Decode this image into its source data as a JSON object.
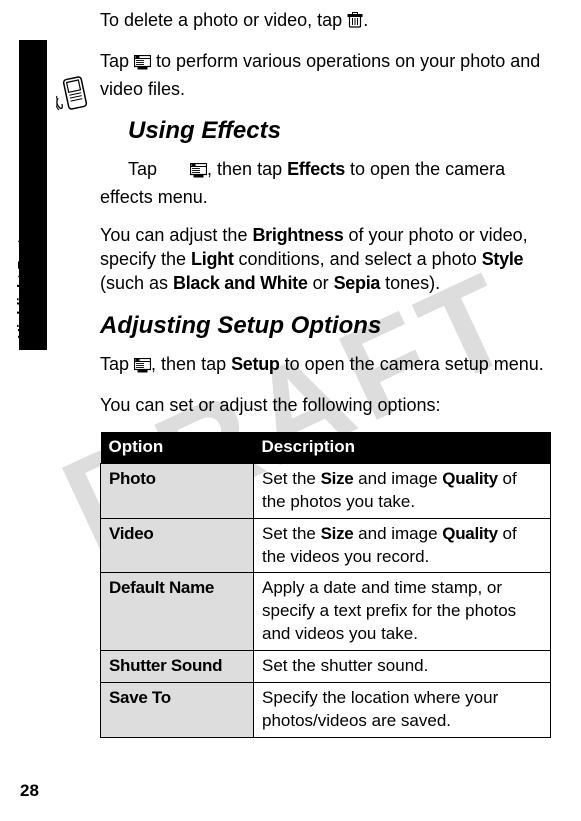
{
  "watermark": "DRAFT",
  "sidebar_label": "Highlight Features",
  "paragraphs": {
    "delete_pre": "To delete a photo or video, tap ",
    "delete_post": ".",
    "ops_pre": "Tap ",
    "ops_post": " to perform various operations on your photo and video files.",
    "effects_heading": "Using Effects",
    "effects_tap_pre": "Tap ",
    "effects_tap_mid": ", then tap ",
    "effects_tap_post": " to open the camera effects menu.",
    "effects_label": "Effects",
    "adjust_pre": "You can adjust the ",
    "adjust_brightness": "Brightness",
    "adjust_mid1": " of your photo or video, specify the ",
    "adjust_light": "Light",
    "adjust_mid2": " conditions, and select a photo ",
    "adjust_style": "Style",
    "adjust_mid3": " (such as ",
    "adjust_bw": "Black and White",
    "adjust_or": " or ",
    "adjust_sepia": "Sepia",
    "adjust_end": " tones).",
    "setup_heading": "Adjusting Setup Options",
    "setup_tap_pre": "Tap ",
    "setup_tap_mid": ", then tap ",
    "setup_tap_label": "Setup",
    "setup_tap_post": " to open the camera setup menu.",
    "options_intro": "You can set or adjust the following options:"
  },
  "table": {
    "header_option": "Option",
    "header_desc": "Description",
    "rows": [
      {
        "option": "Photo",
        "desc_pre": "Set the ",
        "desc_b1": "Size",
        "desc_mid": " and image ",
        "desc_b2": "Quality",
        "desc_post": " of the photos you take."
      },
      {
        "option": "Video",
        "desc_pre": "Set the ",
        "desc_b1": "Size",
        "desc_mid": " and image ",
        "desc_b2": "Quality",
        "desc_post": " of the videos you record."
      },
      {
        "option": "Default Name",
        "desc_plain": "Apply a date and time stamp, or specify a text prefix for the photos and videos you take."
      },
      {
        "option": "Shutter Sound",
        "desc_plain": "Set the shutter sound."
      },
      {
        "option": "Save To",
        "desc_plain": "Specify the location where your photos/videos are saved."
      }
    ]
  },
  "page_number": "28"
}
